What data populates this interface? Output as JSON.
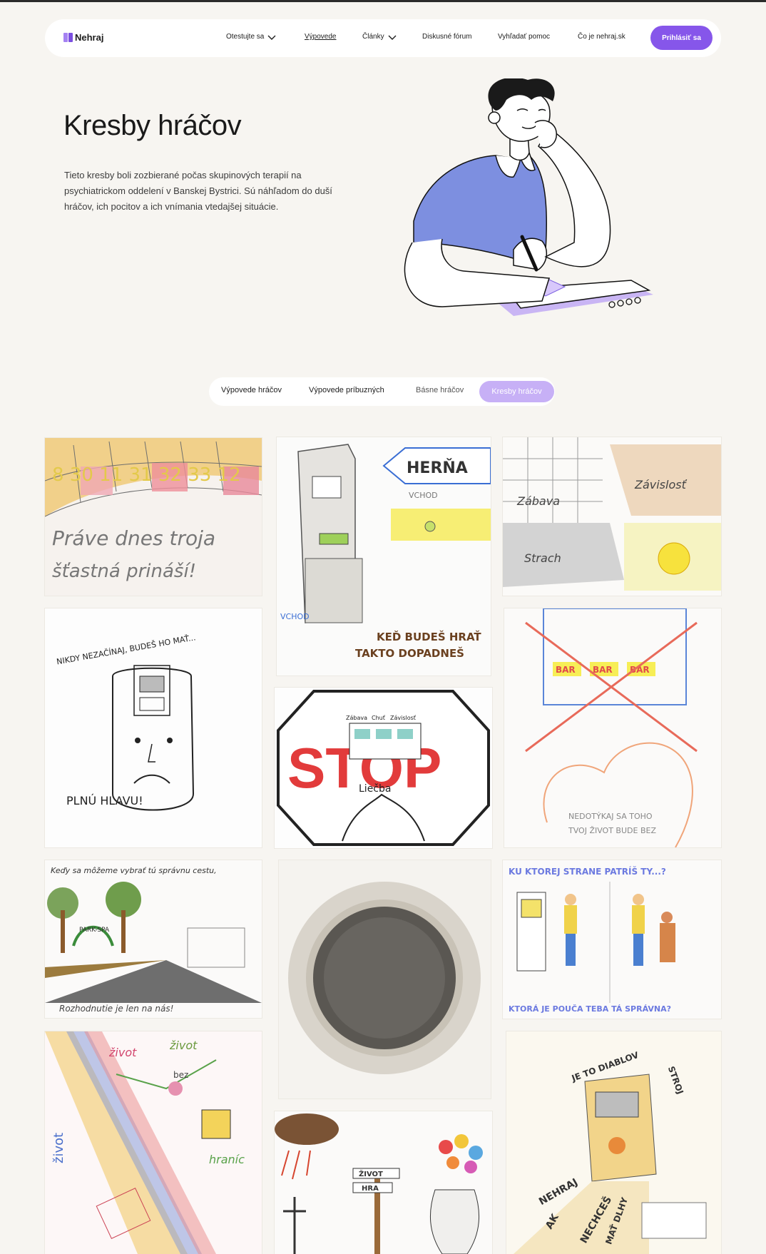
{
  "nav": {
    "logo": "Nehraj",
    "items": [
      {
        "label": "Otestujte sa",
        "dropdown": true
      },
      {
        "label": "Výpovede",
        "active": true
      },
      {
        "label": "Články",
        "dropdown": true
      },
      {
        "label": "Diskusné fórum"
      },
      {
        "label": "Vyhľadať pomoc"
      },
      {
        "label": "Čo je nehraj.sk"
      }
    ],
    "login": "Prihlásiť sa"
  },
  "hero": {
    "title": "Kresby hráčov",
    "text": "Tieto kresby boli zozbierané počas skupinových terapií na psychiatrickom oddelení v Banskej Bystrici. Sú náhľadom do duší hráčov, ich pocitov a ich vnímania vtedajšej situácie."
  },
  "tabs": {
    "items": [
      "Výpovede hráčov",
      "Výpovede príbuzných",
      "Básne hráčov"
    ],
    "active": "Kresby hráčov"
  },
  "drawings": {
    "d1": {
      "line1": "Práve dnes troja",
      "line2": "šťastná prináší!",
      "numbers": "8 30 11 31 32 33 12"
    },
    "d2": {
      "sign": "HERŇA",
      "entrance": "VCHOD",
      "entrance2": "VCHOD",
      "caption1": "KEĎ BUDEŠ HRAŤ",
      "caption2": "TAKTO DOPADNEŠ"
    },
    "d3": {
      "label1": "Zábava",
      "label2": "Závislosť",
      "label3": "Strach"
    },
    "d4": {
      "top": "NIKDY NEZAČÍNAJ, BUDEŠ HO MAŤ...",
      "bottom": "PLNÚ HLAVU!"
    },
    "d5": {
      "text1": "STOP",
      "text2": "Liečba",
      "text3": "Zábava",
      "text4": "Chuť",
      "text5": "Závislosť"
    },
    "d6": {
      "bar": "BAR",
      "text1": "NEDOTÝKAJ SA TOHO",
      "text2": "TVOJ ŽIVOT BUDE BEZ"
    },
    "d7": {
      "top": "Keďy sa môžeme vybrať tú správnu cestu,",
      "bottom": "Rozhodnutie je len na nás!",
      "sign": "PARK-SPA"
    },
    "d8": {},
    "d9": {
      "top": "KU KTOREJ STRANE PATRÍŠ TY...?",
      "bottom": "KTORÁ JE POUČA TEBA TÁ SPRÁVNA?"
    },
    "d10": {
      "w1": "život",
      "w2": "život",
      "w3": "bez",
      "w4": "život",
      "w5": "hraníc"
    },
    "d11": {
      "sign1": "ŽIVOT",
      "sign2": "HRA"
    },
    "d12": {
      "t1": "JE TO DIABLOV",
      "t2": "STROJ",
      "t3": "NEHRAJ",
      "t4": "AK",
      "t5": "NECHCEŠ",
      "t6": "MAŤ DLHY"
    }
  }
}
